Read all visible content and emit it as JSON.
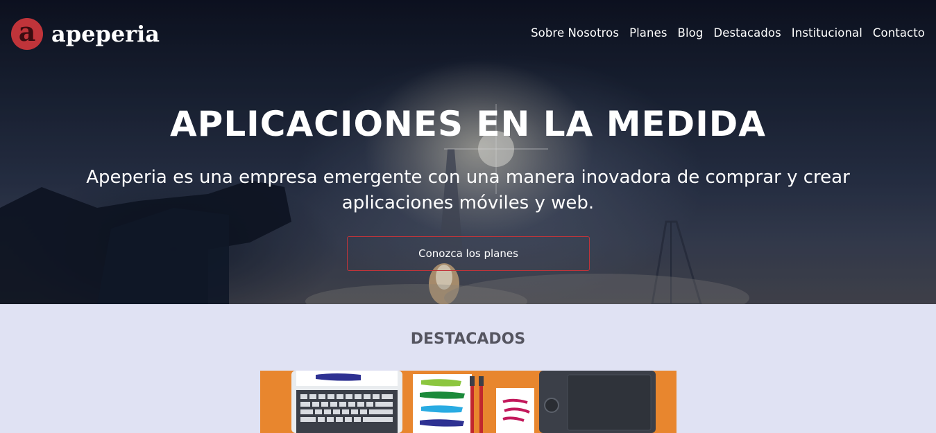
{
  "brand": {
    "logo_letter": "a",
    "name": "apeperia",
    "accent": "#c0343a"
  },
  "nav": {
    "items": [
      {
        "label": "Sobre Nosotros"
      },
      {
        "label": "Planes"
      },
      {
        "label": "Blog"
      },
      {
        "label": "Destacados"
      },
      {
        "label": "Institucional"
      },
      {
        "label": "Contacto"
      }
    ]
  },
  "hero": {
    "title": "APLICACIONES EN LA MEDIDA",
    "subtitle": "Apeperia es una empresa emergente con una manera inovadora de comprar y crear aplicaciones móviles y web.",
    "cta_label": "Conozca los planes"
  },
  "featured": {
    "title": "DESTACADOS",
    "image_background": "#e8862e"
  }
}
